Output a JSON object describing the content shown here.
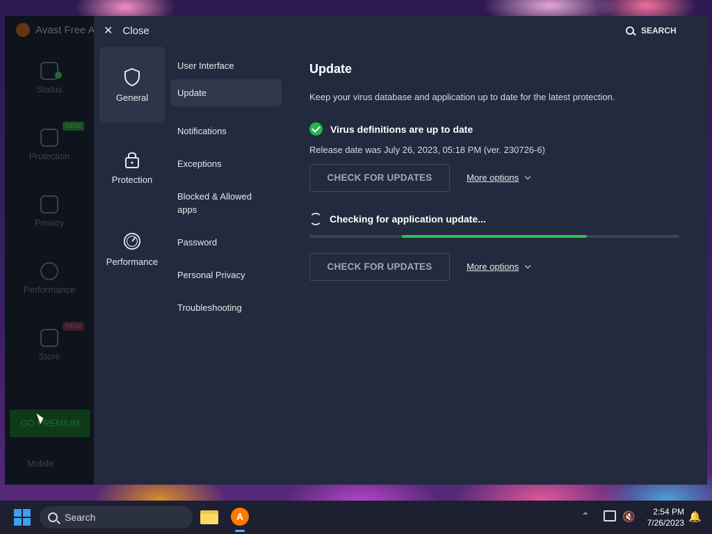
{
  "app": {
    "title": "Avast Free A"
  },
  "main_nav": {
    "items": [
      {
        "label": "Status"
      },
      {
        "label": "Protection",
        "badge": "NEW"
      },
      {
        "label": "Privacy"
      },
      {
        "label": "Performance"
      },
      {
        "label": "Store",
        "badge": "NEW"
      }
    ],
    "go_premium": "GO PREMIUM",
    "mobile": "Mobile"
  },
  "settings": {
    "close_label": "Close",
    "search_label": "SEARCH",
    "categories": [
      {
        "label": "General",
        "icon": "shield-icon",
        "active": true
      },
      {
        "label": "Protection",
        "icon": "lock-icon",
        "active": false
      },
      {
        "label": "Performance",
        "icon": "speedometer-icon",
        "active": false
      }
    ],
    "sub_items": [
      {
        "label": "User Interface"
      },
      {
        "label": "Update",
        "active": true
      },
      {
        "label": "Notifications"
      },
      {
        "label": "Exceptions"
      },
      {
        "label": "Blocked & Allowed apps"
      },
      {
        "label": "Password"
      },
      {
        "label": "Personal Privacy"
      },
      {
        "label": "Troubleshooting"
      }
    ]
  },
  "update": {
    "title": "Update",
    "description": "Keep your virus database and application up to date for the latest protection.",
    "virus_status": "Virus definitions are up to date",
    "release_info": "Release date was July 26, 2023, 05:18 PM (ver. 230726-6)",
    "check_button": "CHECK FOR UPDATES",
    "more_options": "More options",
    "app_status": "Checking for application update...",
    "progress": {
      "start": 0.25,
      "end": 0.75
    },
    "check_button_2": "CHECK FOR UPDATES",
    "more_options_2": "More options"
  },
  "taskbar": {
    "search_placeholder": "Search",
    "time": "2:54 PM",
    "date": "7/26/2023"
  },
  "colors": {
    "accent_green": "#2bc24e",
    "panel_bg": "#222a3e",
    "avast_orange": "#ff7800"
  }
}
